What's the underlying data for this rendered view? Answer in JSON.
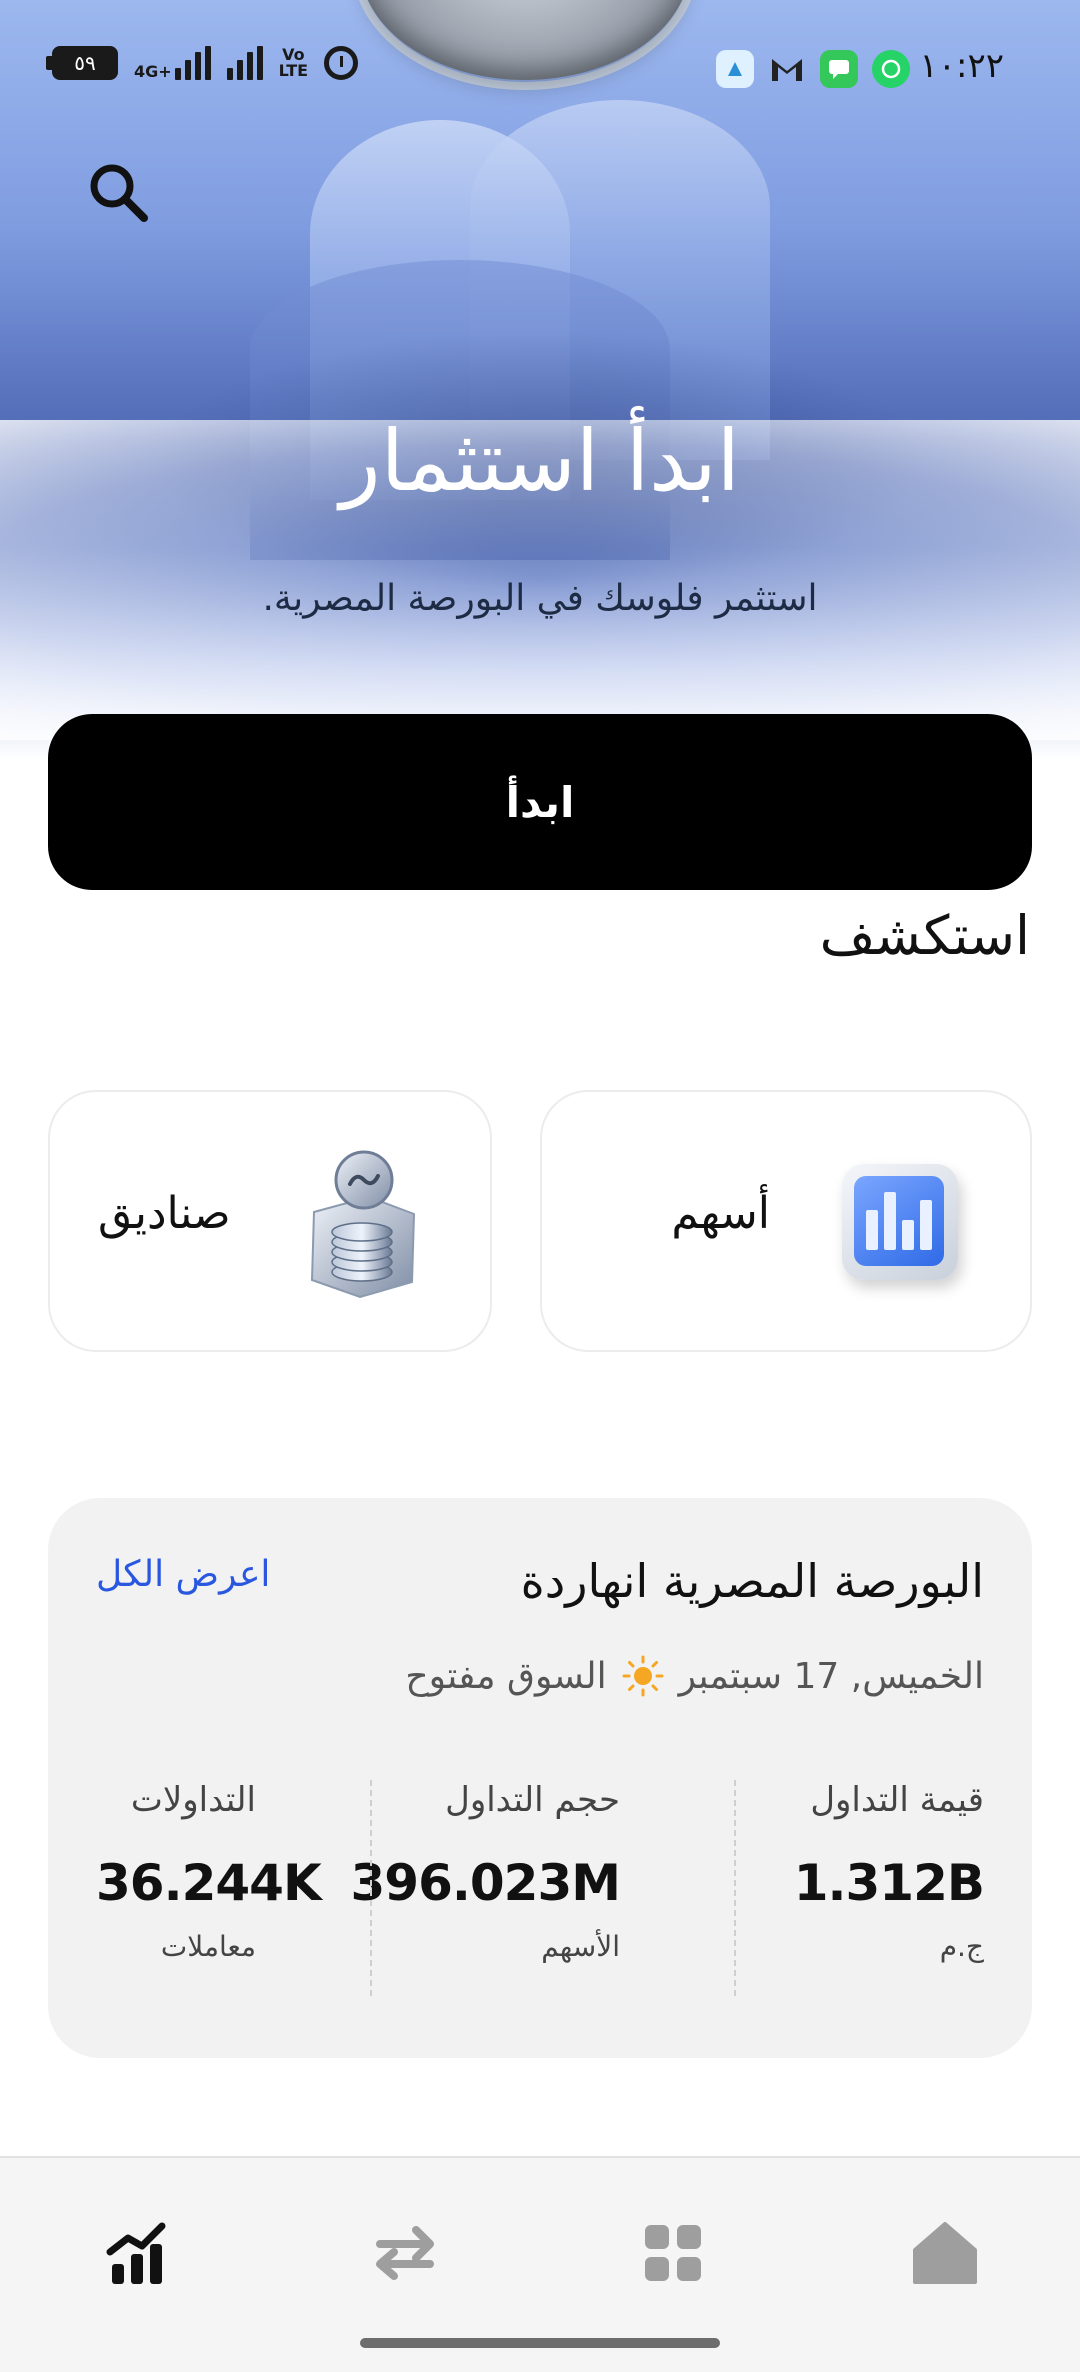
{
  "status_bar": {
    "time": "١٠:٢٢",
    "battery": "٥٩",
    "network_label": "4G+",
    "volte_label": "Vo\nLTE"
  },
  "hero": {
    "title": "ابدأ استثمار",
    "subtitle": "استثمر فلوسك في البورصة المصرية."
  },
  "cta": {
    "label": "ابدأ"
  },
  "explore": {
    "title": "استكشف",
    "cards": [
      {
        "label": "أسهم",
        "icon": "bar-chart-icon"
      },
      {
        "label": "صناديق",
        "icon": "fund-coin-icon"
      }
    ]
  },
  "market": {
    "title": "البورصة المصرية انهاردة",
    "view_all": "اعرض الكل",
    "date": "الخميس, 17 سبتمبر",
    "status": "السوق مفتوح",
    "stats": [
      {
        "label": "قيمة التداول",
        "value": "1.312B",
        "unit": "ج.م"
      },
      {
        "label": "حجم التداول",
        "value": "396.023M",
        "unit": "الأسهم"
      },
      {
        "label": "التداولات",
        "value": "36.244K",
        "unit": "معاملات"
      }
    ]
  },
  "bottom_nav": {
    "items": [
      {
        "name": "markets",
        "icon": "chart-icon",
        "active": true
      },
      {
        "name": "transfers",
        "icon": "swap-arrows-icon",
        "active": false
      },
      {
        "name": "apps",
        "icon": "grid-icon",
        "active": false
      },
      {
        "name": "home",
        "icon": "home-icon",
        "active": false
      }
    ]
  },
  "colors": {
    "accent_link": "#2a57e0",
    "cta_background": "#000000",
    "panel_background": "#f2f2f3",
    "nav_active": "#111111",
    "nav_inactive": "#9e9e9e"
  }
}
